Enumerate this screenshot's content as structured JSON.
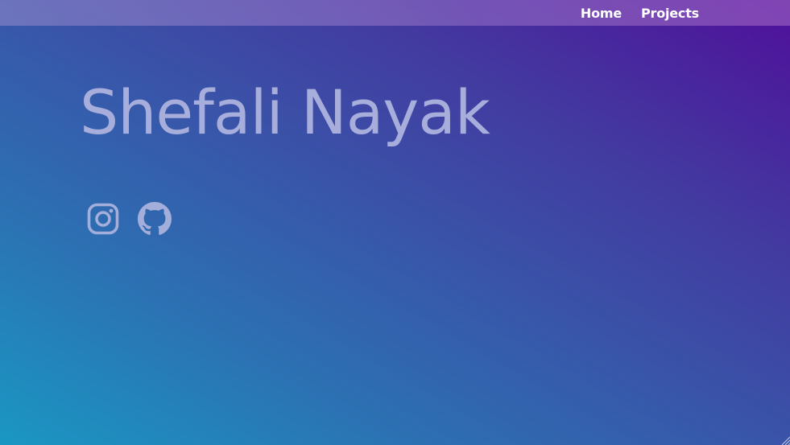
{
  "nav": {
    "items": [
      {
        "label": "Home"
      },
      {
        "label": "Projects"
      }
    ]
  },
  "hero": {
    "title": "Shefali Nayak"
  },
  "socials": [
    {
      "icon": "instagram-icon"
    },
    {
      "icon": "github-icon"
    }
  ],
  "colors": {
    "gradient_start": "#1a97c3",
    "gradient_end": "#4f0f9a",
    "title_color": "#a8aedb",
    "icon_color": "#a3aedb",
    "nav_text": "#ffffff"
  }
}
